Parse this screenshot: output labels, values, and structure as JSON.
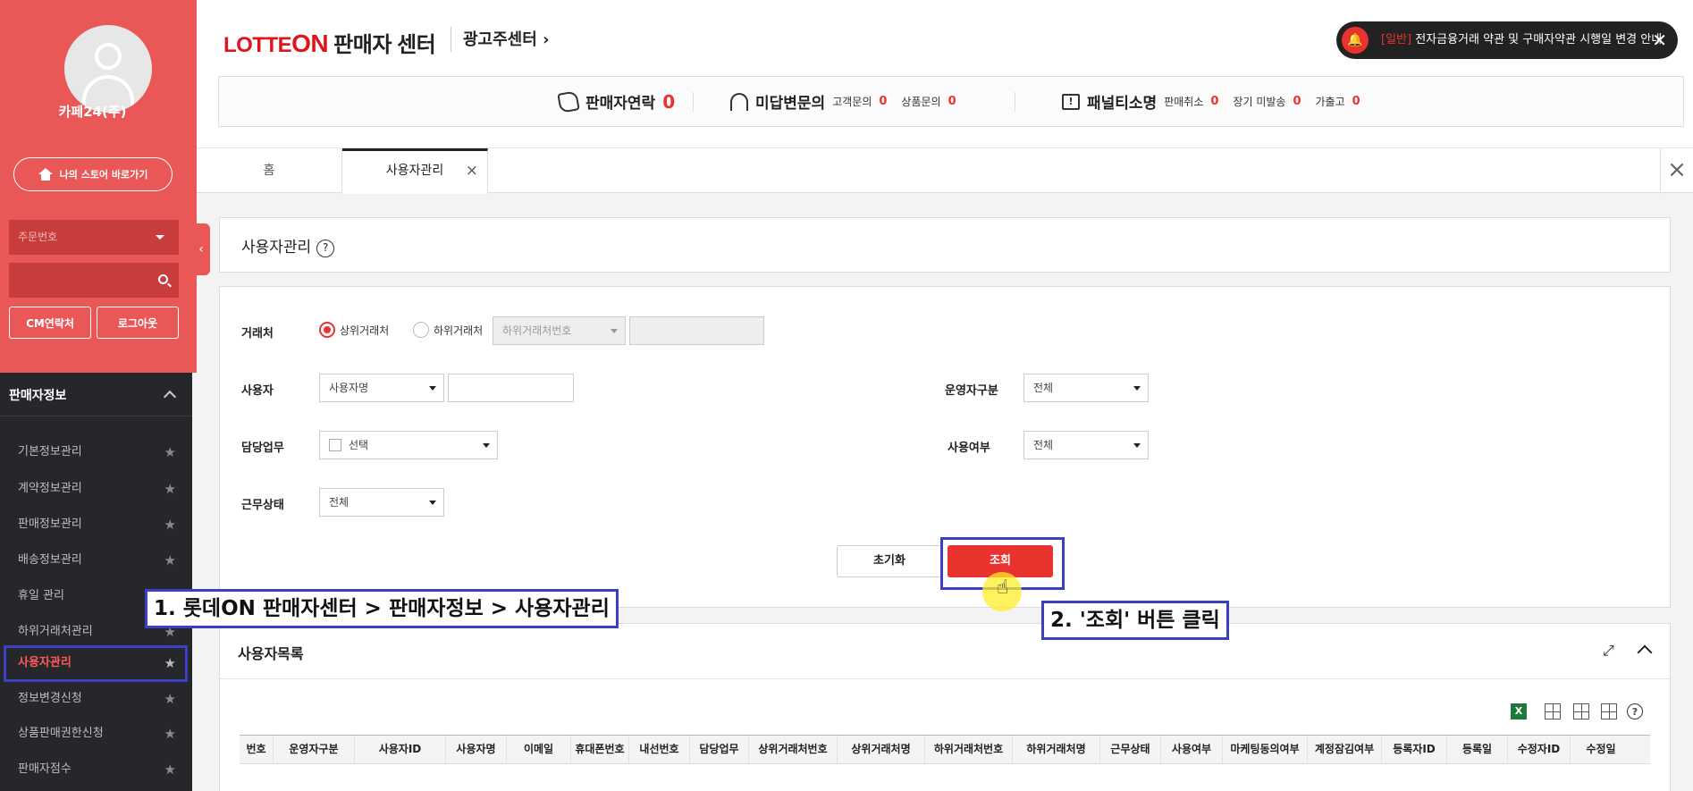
{
  "sidebar": {
    "shop_name": "카페24(주)",
    "store_button": "나의 스토어 바로가기",
    "select_value": "주문번호",
    "cm_button": "CM연락처",
    "logout_button": "로그아웃",
    "menu_title": "판매자정보",
    "items": [
      {
        "label": "기본정보관리"
      },
      {
        "label": "계약정보관리"
      },
      {
        "label": "판매정보관리"
      },
      {
        "label": "배송정보관리"
      },
      {
        "label": "휴일 관리"
      },
      {
        "label": "하위거래처관리"
      },
      {
        "label": "사용자관리"
      },
      {
        "label": "정보변경신청"
      },
      {
        "label": "상품판매권한신청"
      },
      {
        "label": "판매자점수"
      }
    ]
  },
  "header": {
    "logo_lotte": "LOTTE",
    "logo_on": "ON",
    "logo_seller": "판매자 센터",
    "ad_center": "광고주센터 ›",
    "notice_tag": "[일반]",
    "notice_text": "전자금융거래 약관 및 구매자약관 시행일 변경 안내",
    "stats": {
      "contact_label": "판매자연락",
      "contact_count": "0",
      "inquiry_label": "미답변문의",
      "customer_inquiry_label": "고객문의",
      "customer_inquiry_count": "0",
      "product_inquiry_label": "상품문의",
      "product_inquiry_count": "0",
      "penalty_label": "패널티소명",
      "sale_cancel_label": "판매취소",
      "sale_cancel_count": "0",
      "long_unshipped_label": "장기 미발송",
      "long_unshipped_count": "0",
      "fake_label": "가출고",
      "fake_count": "0"
    }
  },
  "tabs": [
    {
      "label": "홈"
    },
    {
      "label": "사용자관리"
    }
  ],
  "page": {
    "title": "사용자관리",
    "form": {
      "partner_label": "거래처",
      "radio_upper": "상위거래처",
      "radio_lower": "하위거래처",
      "lower_select_placeholder": "하위거래처번호",
      "user_label": "사용자",
      "user_select": "사용자명",
      "role_label": "담당업무",
      "role_select": "선택",
      "work_status_label": "근무상태",
      "work_status_select": "전체",
      "operator_label": "운영자구분",
      "operator_select": "전체",
      "use_label": "사용여부",
      "use_select": "전체",
      "reset_button": "초기화",
      "search_button": "조회"
    },
    "list": {
      "title": "사용자목록",
      "excel_icon_text": "X",
      "columns": [
        "번호",
        "운영자구분",
        "사용자ID",
        "사용자명",
        "이메일",
        "휴대폰번호",
        "내선번호",
        "담당업무",
        "상위거래처번호",
        "상위거래처명",
        "하위거래처번호",
        "하위거래처명",
        "근무상태",
        "사용여부",
        "마케팅동의여부",
        "계정잠김여부",
        "등록자ID",
        "등록일",
        "수정자ID",
        "수정일"
      ]
    }
  },
  "callouts": {
    "step1": "1. 롯데ON 판매자센터 > 판매자정보 > 사용자관리",
    "step2": "2. '조회' 버튼 클릭"
  },
  "colors": {
    "brand_red": "#e8332f",
    "sidebar_red": "#ea5757",
    "sidebar_dark": "#26272b",
    "annotation_blue": "#3d3fc2"
  }
}
